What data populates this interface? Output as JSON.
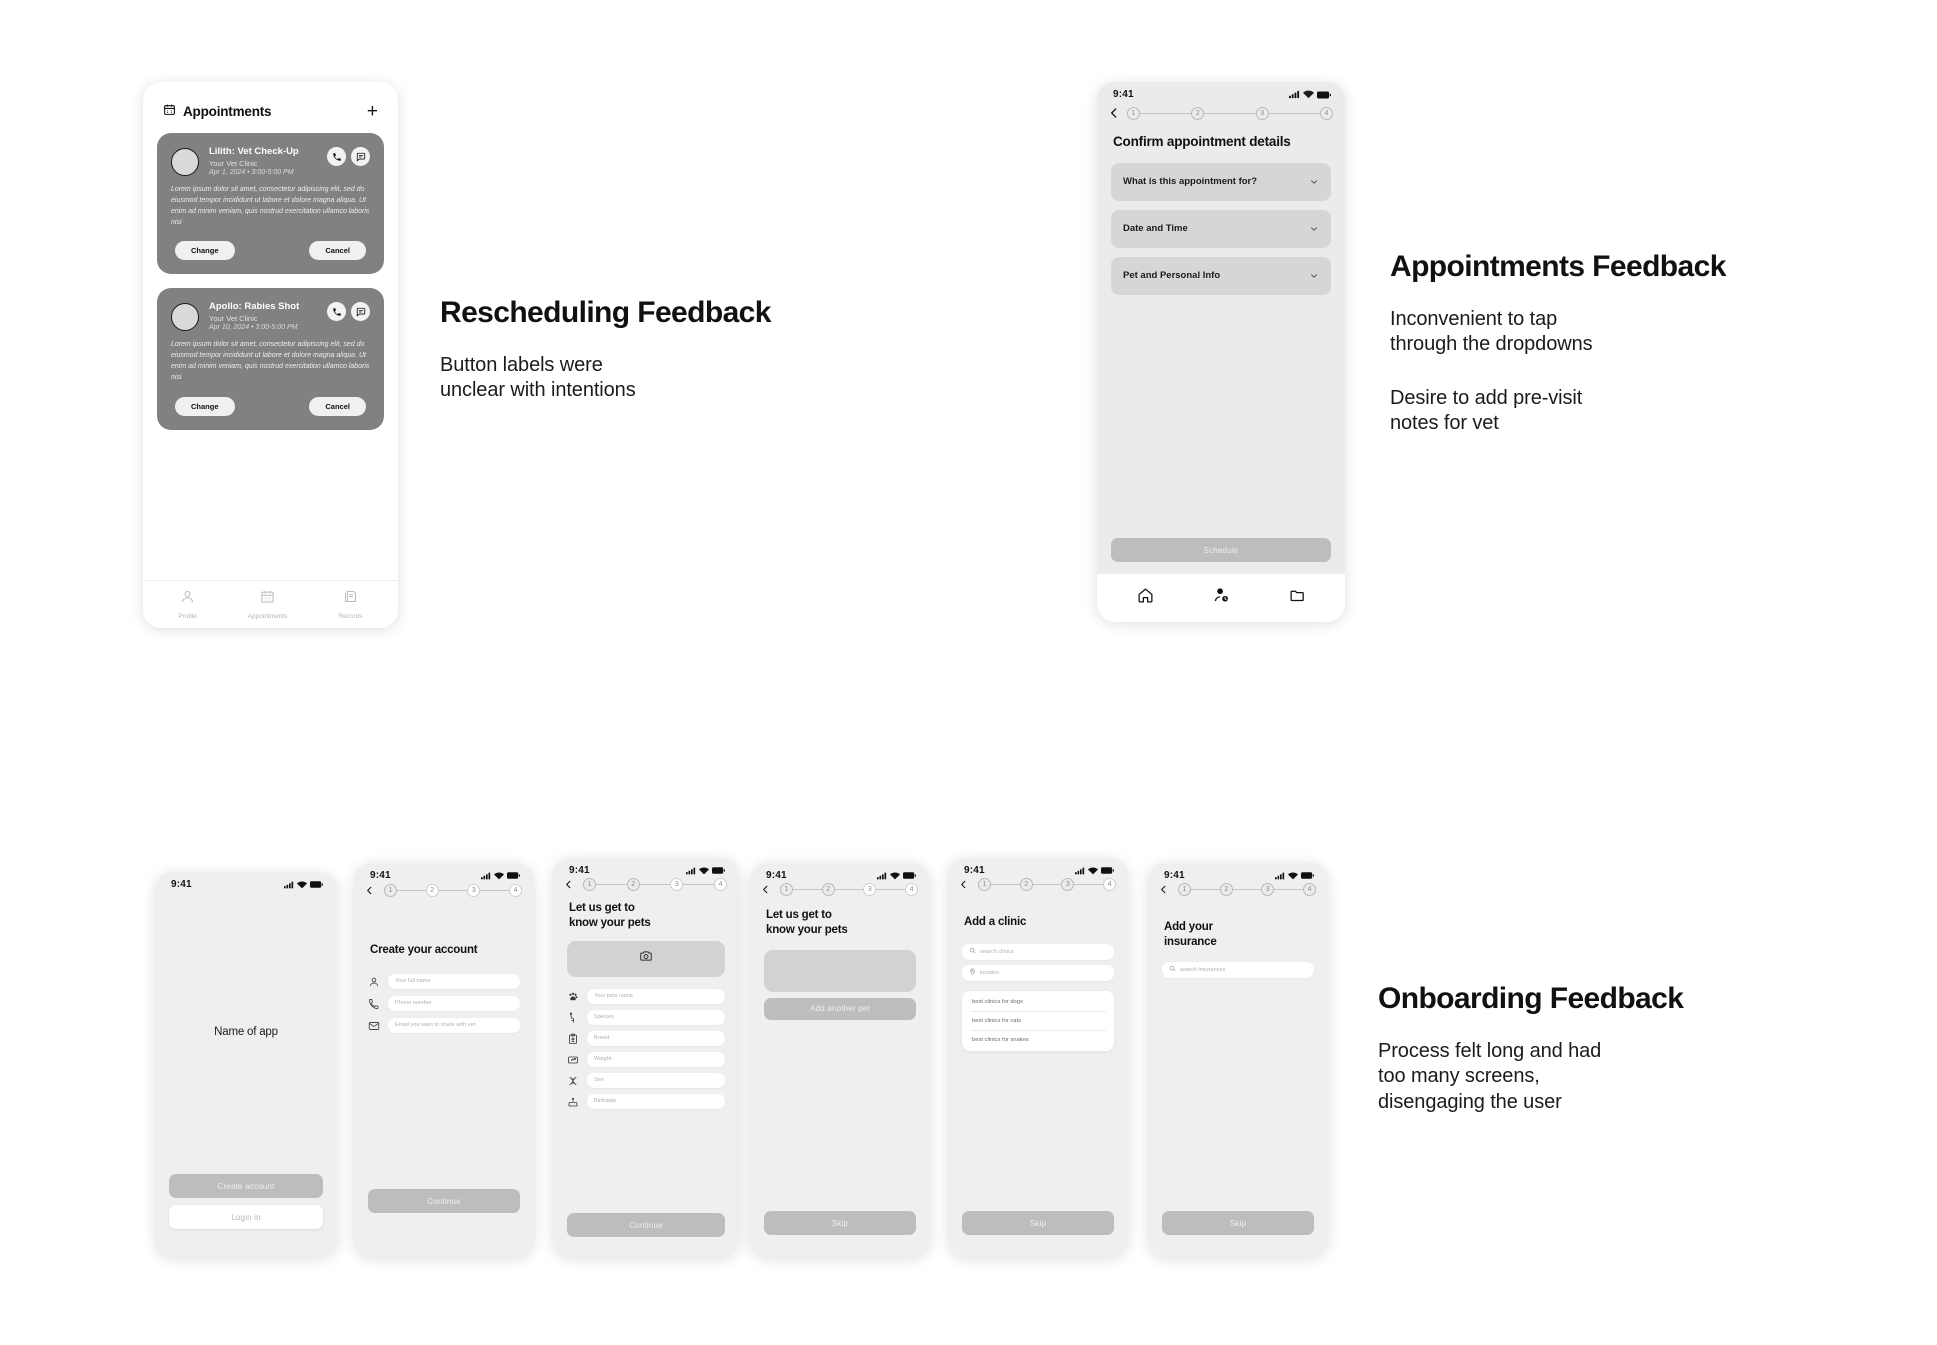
{
  "page": {
    "background": "#ffffff"
  },
  "annotations": [
    {
      "id": "rescheduling",
      "title": "Rescheduling Feedback",
      "notes": [
        "Button labels were\nunclear with intentions"
      ]
    },
    {
      "id": "appointments",
      "title": "Appointments Feedback",
      "notes": [
        "Inconvenient to tap\nthrough the dropdowns",
        "Desire to add pre-visit\nnotes for vet"
      ]
    },
    {
      "id": "onboarding",
      "title": "Onboarding Feedback",
      "notes": [
        "Process felt long and had\ntoo many screens,\ndisengaging the user"
      ]
    }
  ],
  "appointments_screen": {
    "header": {
      "title": "Appointments",
      "icon": "calendar-icon",
      "add_label": "+"
    },
    "cards": [
      {
        "title": "Lilith: Vet Check-Up",
        "clinic": "Your Vet Clinic",
        "when": "Apr 1, 2024 • 3:00-5:00 PM",
        "body": "Lorem ipsum dolor sit amet, consectetur adipiscing elit, sed do eiusmod tempor incididunt ut labore et dolore magna aliqua. Ut enim ad minim veniam, quis nostrud exercitation ullamco laboris nisi",
        "primary_label": "Change",
        "secondary_label": "Cancel"
      },
      {
        "title": "Apollo: Rabies Shot",
        "clinic": "Your Vet Clinic",
        "when": "Apr 10, 2024 • 3:00-5:00 PM",
        "body": "Lorem ipsum dolor sit amet, consectetur adipiscing elit, sed do eiusmod tempor incididunt ut labore et dolore magna aliqua. Ut enim ad minim veniam, quis nostrud exercitation ullamco laboris nisi",
        "primary_label": "Change",
        "secondary_label": "Cancel"
      }
    ],
    "tabs": [
      {
        "label": "Profile",
        "icon": "person-icon"
      },
      {
        "label": "Appointments",
        "icon": "calendar-icon"
      },
      {
        "label": "Records",
        "icon": "files-icon"
      }
    ]
  },
  "confirm_screen": {
    "status": {
      "time": "9:41"
    },
    "steps": [
      "1",
      "2",
      "3",
      "4"
    ],
    "title": "Confirm appointment details",
    "dropdowns": [
      {
        "label": "What is this appointment for?"
      },
      {
        "label": "Date and Time"
      },
      {
        "label": "Pet and Personal Info"
      }
    ],
    "cta": "Schedule",
    "tabs": [
      {
        "icon": "home-icon"
      },
      {
        "icon": "person-clock-icon"
      },
      {
        "icon": "folder-icon"
      }
    ]
  },
  "onboarding": {
    "screens": [
      {
        "id": "welcome",
        "status_time": "9:41",
        "app_name": "Name of app",
        "primary_cta": "Create account",
        "secondary_cta": "Login in"
      },
      {
        "id": "create-account",
        "status_time": "9:41",
        "steps": [
          "1",
          "2",
          "3",
          "4"
        ],
        "active_step": 0,
        "title": "Create your account",
        "fields": [
          {
            "placeholder": "Your full name",
            "icon": "person-icon"
          },
          {
            "placeholder": "Phone number",
            "icon": "phone-icon"
          },
          {
            "placeholder": "Email you want to share with vet",
            "icon": "mail-icon"
          }
        ],
        "cta": "Continue"
      },
      {
        "id": "pet-details",
        "status_time": "9:41",
        "steps": [
          "1",
          "2",
          "3",
          "4"
        ],
        "active_step": 1,
        "title": "Let us get to\nknow your pets",
        "photo_icon": "camera-icon",
        "fields": [
          {
            "placeholder": "Your pets name",
            "icon": "paw-icon"
          },
          {
            "placeholder": "Species",
            "icon": "dog-icon"
          },
          {
            "placeholder": "Breed",
            "icon": "clipboard-icon"
          },
          {
            "placeholder": "Weight",
            "icon": "scale-icon"
          },
          {
            "placeholder": "Sex",
            "icon": "dna-icon"
          },
          {
            "placeholder": "Birthdate",
            "icon": "cake-icon"
          }
        ],
        "cta": "Continue"
      },
      {
        "id": "pet-list",
        "status_time": "9:41",
        "steps": [
          "1",
          "2",
          "3",
          "4"
        ],
        "active_step": 2,
        "title": "Let us get to\nknow your pets",
        "add_pet_label": "Add another pet",
        "cta": "Skip"
      },
      {
        "id": "add-clinic",
        "status_time": "9:41",
        "steps": [
          "1",
          "2",
          "3",
          "4"
        ],
        "active_step": 3,
        "title": "Add a clinic",
        "search_placeholder": "search clinics",
        "location_placeholder": "location",
        "suggestions": [
          "best clinics for dogs",
          "best clinics for cats",
          "best clinics for snakes"
        ],
        "cta": "Skip"
      },
      {
        "id": "add-insurance",
        "status_time": "9:41",
        "steps": [
          "1",
          "2",
          "3",
          "4"
        ],
        "active_step": 3,
        "title": "Add your\ninsurance",
        "search_placeholder": "search insurances",
        "cta": "Skip"
      }
    ]
  }
}
